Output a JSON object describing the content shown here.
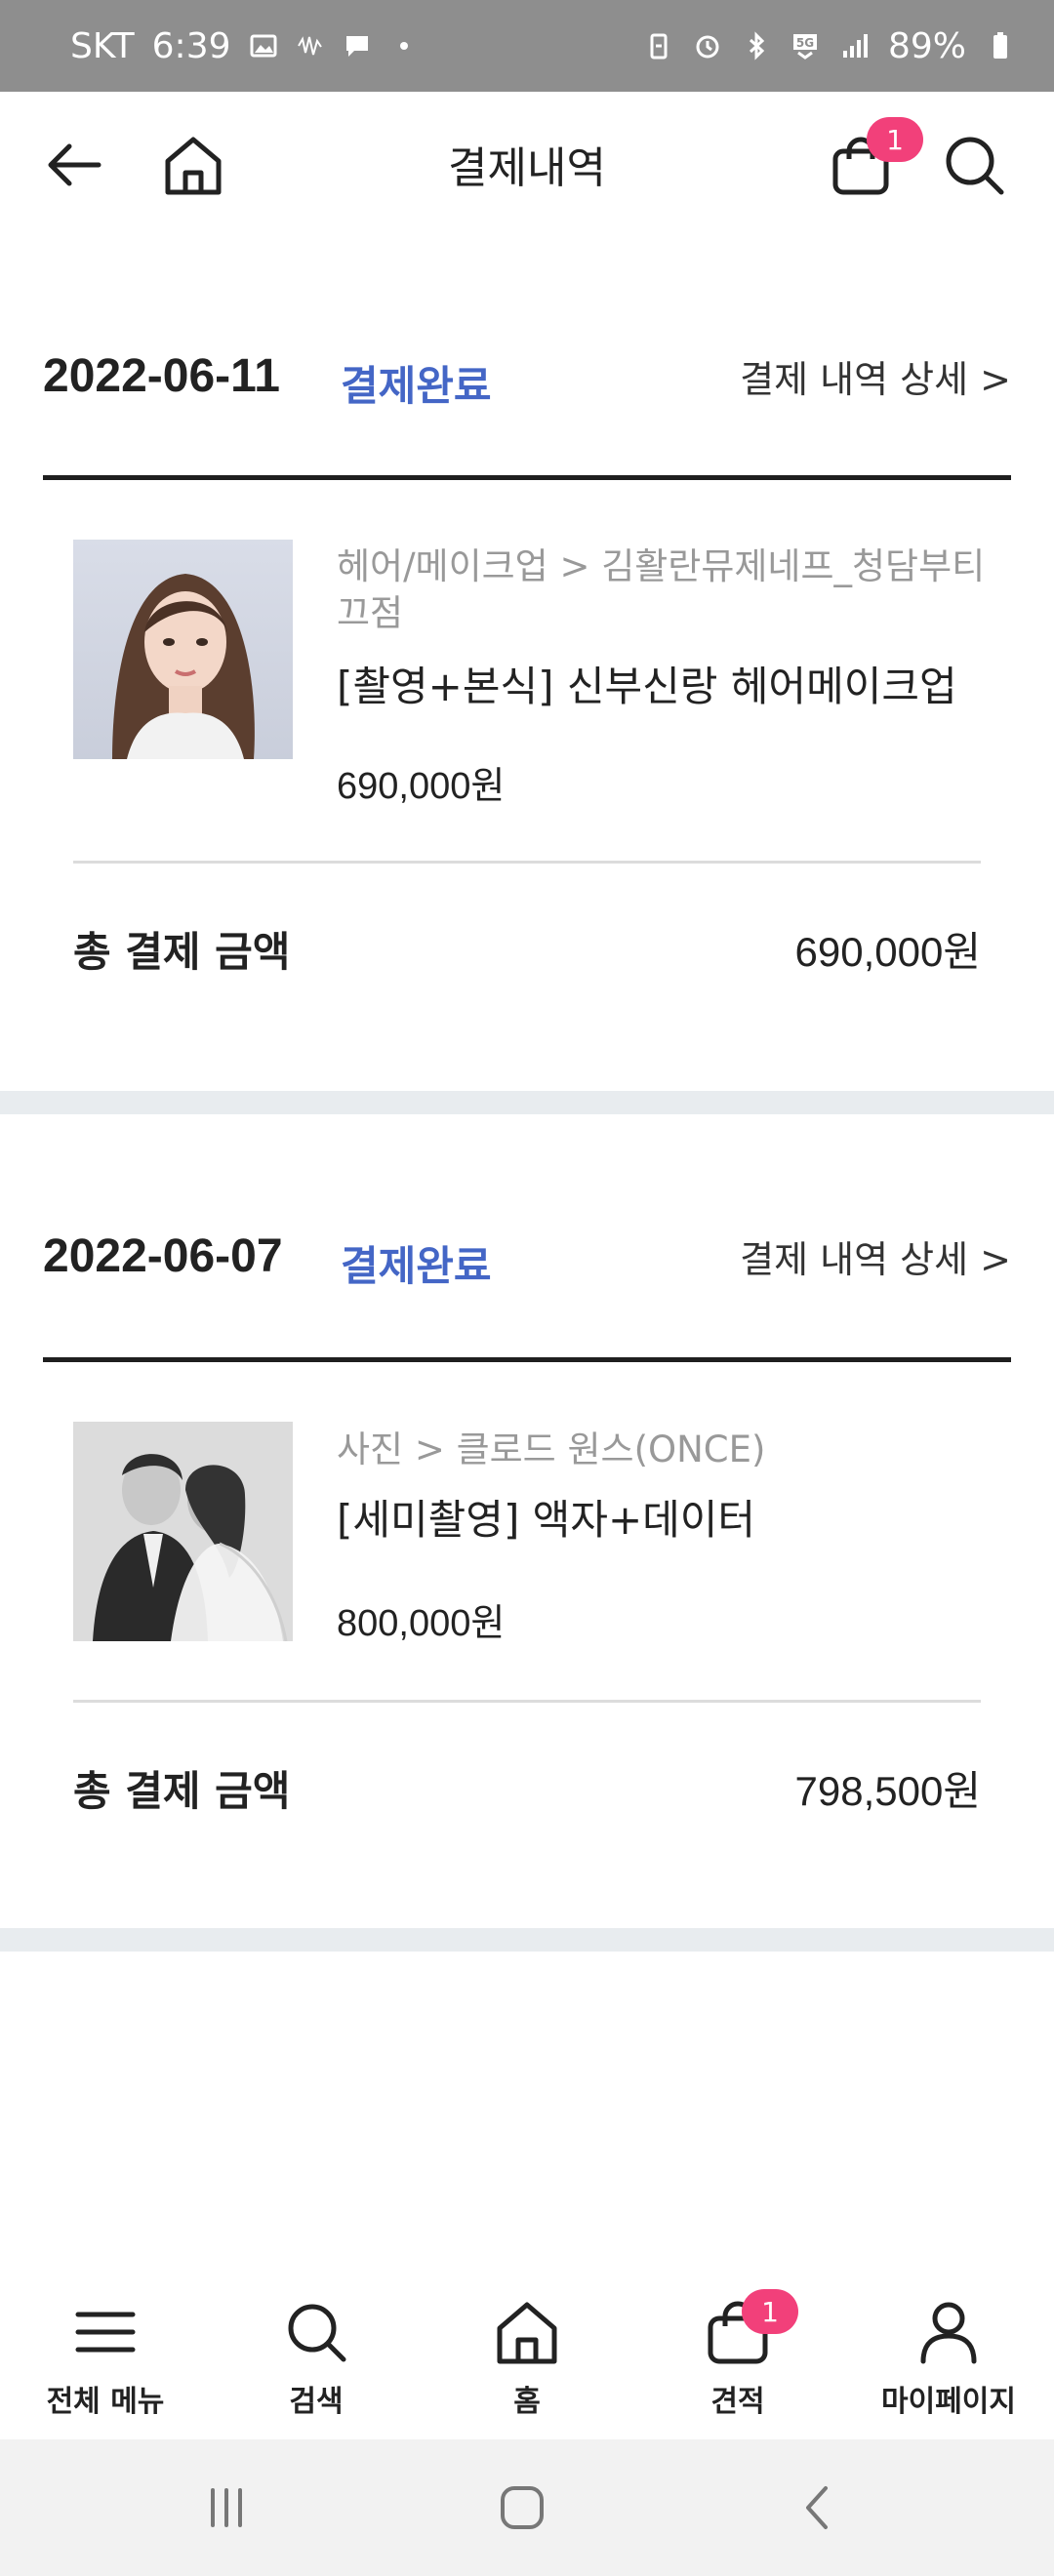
{
  "status_bar": {
    "carrier": "SKT",
    "time": "6:39",
    "battery": "89%",
    "icons": [
      "image-icon",
      "signal-wave-icon",
      "chat-icon",
      "dot-icon",
      "battery-saver-icon",
      "alarm-icon",
      "bluetooth-icon",
      "5g-icon",
      "signal-bars-icon",
      "battery-icon"
    ]
  },
  "header": {
    "title": "결제내역",
    "cart_badge": "1"
  },
  "orders": [
    {
      "date": "2022-06-11",
      "status": "결제완료",
      "detail_link": "결제 내역 상세 >",
      "item": {
        "category": "헤어/메이크업 > 김활란뮤제네프_청담부티끄점",
        "name": "[촬영+본식] 신부신랑 헤어메이크업",
        "price": "690,000원",
        "image_icon": "bride-portrait-image"
      },
      "total_label": "총 결제 금액",
      "total_value": "690,000원"
    },
    {
      "date": "2022-06-07",
      "status": "결제완료",
      "detail_link": "결제 내역 상세 >",
      "item": {
        "category": "사진 > 클로드 원스(ONCE)",
        "name": "[세미촬영] 액자+데이터",
        "price": "800,000원",
        "image_icon": "couple-photo-image"
      },
      "total_label": "총 결제 금액",
      "total_value": "798,500원"
    }
  ],
  "tabbar": {
    "items": [
      {
        "label": "전체 메뉴",
        "icon": "menu-icon"
      },
      {
        "label": "검색",
        "icon": "search-icon"
      },
      {
        "label": "홈",
        "icon": "home-icon"
      },
      {
        "label": "견적",
        "icon": "bag-icon",
        "badge": "1"
      },
      {
        "label": "마이페이지",
        "icon": "person-icon"
      }
    ]
  },
  "colors": {
    "accent": "#4466c6",
    "badge": "#f2407a",
    "status_bar": "#8e8e8e",
    "separator": "#e8ecef"
  }
}
